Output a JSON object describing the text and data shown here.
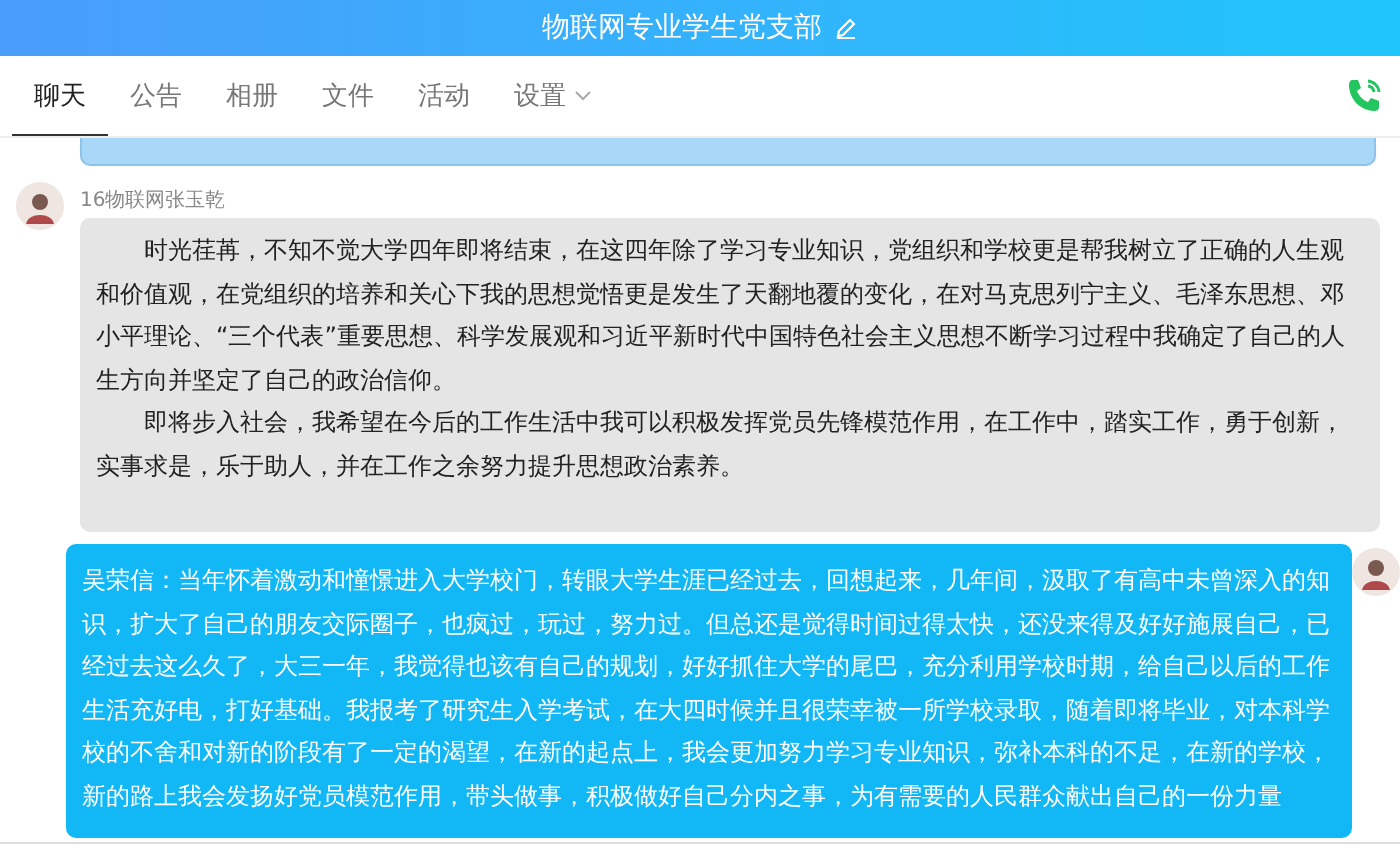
{
  "header": {
    "title": "物联网专业学生党支部"
  },
  "tabs": [
    {
      "label": "聊天",
      "selected": true,
      "kind": "plain"
    },
    {
      "label": "公告",
      "selected": false,
      "kind": "plain"
    },
    {
      "label": "相册",
      "selected": false,
      "kind": "plain"
    },
    {
      "label": "文件",
      "selected": false,
      "kind": "plain"
    },
    {
      "label": "活动",
      "selected": false,
      "kind": "plain"
    },
    {
      "label": "设置",
      "selected": false,
      "kind": "dropdown"
    }
  ],
  "messages": [
    {
      "kind": "received",
      "sender": "16物联网张玉乾",
      "indent": true,
      "paragraphs": [
        "时光荏苒，不知不觉大学四年即将结束，在这四年除了学习专业知识，党组织和学校更是帮我树立了正确的人生观和价值观，在党组织的培养和关心下我的思想觉悟更是发生了天翻地覆的变化，在对马克思列宁主义、毛泽东思想、邓小平理论、“三个代表”重要思想、科学发展观和习近平新时代中国特色社会主义思想不断学习过程中我确定了自己的人生方向并坚定了自己的政治信仰。",
        "即将步入社会，我希望在今后的工作生活中我可以积极发挥党员先锋模范作用，在工作中，踏实工作，勇于创新，实事求是，乐于助人，并在工作之余努力提升思想政治素养。"
      ]
    },
    {
      "kind": "sent",
      "indent": false,
      "paragraphs": [
        "吴荣信：当年怀着激动和憧憬进入大学校门，转眼大学生涯已经过去，回想起来，几年间，汲取了有高中未曾深入的知识，扩大了自己的朋友交际圈子，也疯过，玩过，努力过。但总还是觉得时间过得太快，还没来得及好好施展自己，已经过去这么久了，大三一年，我觉得也该有自己的规划，好好抓住大学的尾巴，充分利用学校时期，给自己以后的工作生活充好电，打好基础。我报考了研究生入学考试，在大四时候并且很荣幸被一所学校录取，随着即将毕业，对本科学校的不舍和对新的阶段有了一定的渴望，在新的起点上，我会更加努力学习专业知识，弥补本科的不足，在新的学校，新的路上我会发扬好党员模范作用，带头做事，积极做好自己分内之事，为有需要的人民群众献出自己的一份力量"
      ]
    }
  ]
}
